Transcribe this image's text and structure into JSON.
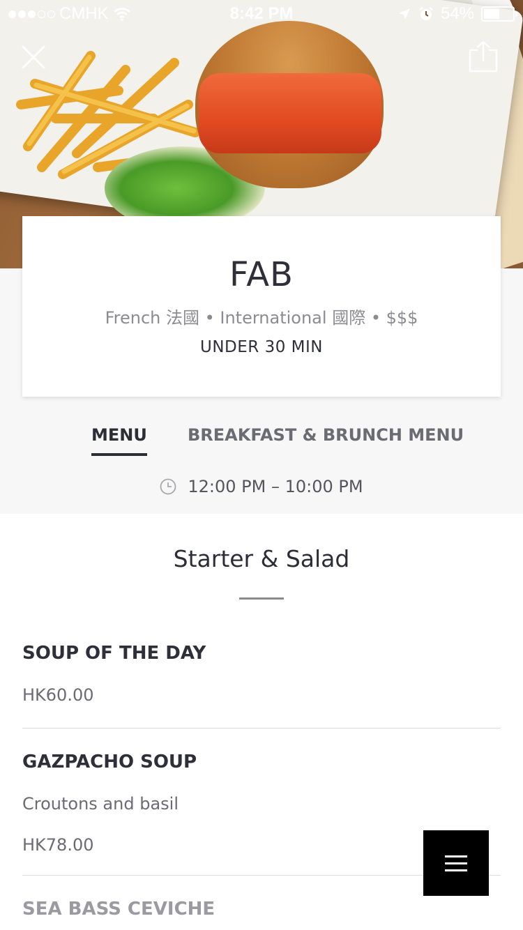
{
  "status_bar": {
    "carrier": "CMHK",
    "time": "8:42 PM",
    "battery": "54%",
    "battery_level": 0.54,
    "signal_bars_filled": 3,
    "signal_bars_total": 5
  },
  "restaurant": {
    "name": "FAB",
    "cuisine": "French 法國 • International 國際 • $$$",
    "delivery_time": "UNDER 30 MIN"
  },
  "tabs": [
    {
      "label": "MENU",
      "active": true
    },
    {
      "label": "BREAKFAST & BRUNCH MENU",
      "active": false
    }
  ],
  "hours": "12:00 PM – 10:00 PM",
  "section": {
    "title": "Starter & Salad"
  },
  "items": [
    {
      "name": "SOUP OF THE DAY",
      "description": "",
      "price": "HK60.00"
    },
    {
      "name": "GAZPACHO SOUP",
      "description": "Croutons and basil",
      "price": "HK78.00"
    },
    {
      "name": "SEA BASS CEVICHE",
      "description": "",
      "price": ""
    }
  ],
  "colors": {
    "primary_text": "#2d2d38",
    "secondary_text": "#6b6b73",
    "band": "#f7f7f7",
    "fab": "#000000"
  },
  "icons": {
    "close": "close-icon",
    "share": "share-icon",
    "clock": "clock-icon",
    "menu": "hamburger-icon"
  }
}
